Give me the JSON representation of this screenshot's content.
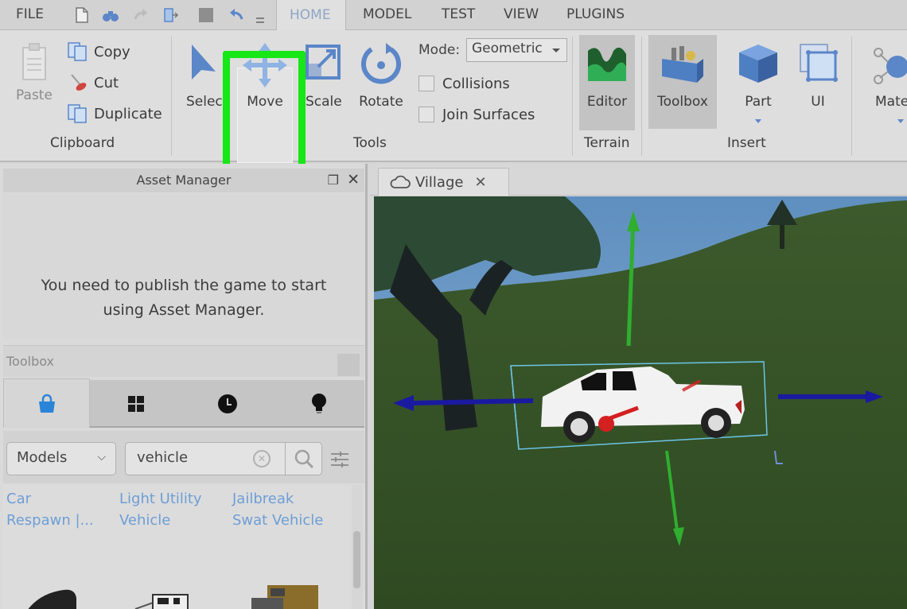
{
  "menu": {
    "file": "FILE",
    "quick_access_icons": [
      "new-file-icon",
      "binoculars-icon",
      "redo-icon",
      "publish-icon",
      "stop-icon",
      "undo-icon",
      "customize-icon"
    ],
    "tabs": [
      {
        "label": "HOME",
        "active": true
      },
      {
        "label": "MODEL",
        "active": false
      },
      {
        "label": "TEST",
        "active": false
      },
      {
        "label": "VIEW",
        "active": false
      },
      {
        "label": "PLUGINS",
        "active": false
      }
    ]
  },
  "ribbon": {
    "clipboard": {
      "group_label": "Clipboard",
      "paste": "Paste",
      "copy": "Copy",
      "cut": "Cut",
      "duplicate": "Duplicate"
    },
    "tools": {
      "group_label": "Tools",
      "select": "Select",
      "move": "Move",
      "scale": "Scale",
      "rotate": "Rotate",
      "mode_label": "Mode:",
      "mode_value": "Geometric",
      "collisions": "Collisions",
      "collisions_checked": false,
      "join_surfaces": "Join Surfaces",
      "join_surfaces_checked": false
    },
    "terrain": {
      "group_label": "Terrain",
      "editor": "Editor"
    },
    "insert": {
      "group_label": "Insert",
      "toolbox": "Toolbox",
      "part": "Part",
      "ui": "UI"
    },
    "material": {
      "label": "Mate"
    },
    "highlight_color": "#17e617"
  },
  "asset_manager": {
    "title": "Asset Manager",
    "message_line1": "You need to publish the game to start",
    "message_line2": "using Asset Manager."
  },
  "toolbox": {
    "title": "Toolbox",
    "tabs": [
      {
        "icon": "bag-icon",
        "active": true
      },
      {
        "icon": "grid-icon",
        "active": false
      },
      {
        "icon": "clock-icon",
        "active": false
      },
      {
        "icon": "lightbulb-icon",
        "active": false
      }
    ],
    "category": "Models",
    "search_value": "vehicle",
    "results": [
      {
        "line1": "Car",
        "line2": "Respawn |..."
      },
      {
        "line1": "Light Utility",
        "line2": "Vehicle"
      },
      {
        "line1": "Jailbreak",
        "line2": "Swat Vehicle"
      }
    ]
  },
  "viewport": {
    "tab_label": "Village",
    "gizmo_colors": {
      "y": "#2fae2f",
      "x": "#1a1aa0",
      "z": "#d42020"
    }
  }
}
